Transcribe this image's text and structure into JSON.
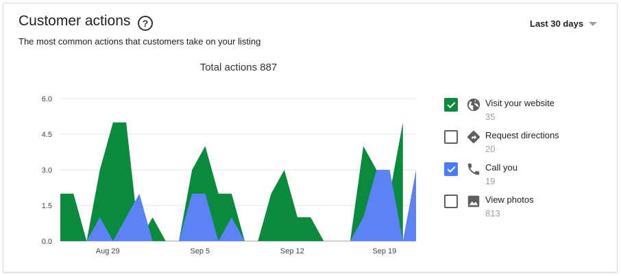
{
  "header": {
    "title": "Customer actions",
    "help_icon": "?",
    "subtitle": "The most common actions that customers take on your listing",
    "date_range": "Last 30 days"
  },
  "chart": {
    "total_label": "Total actions 887"
  },
  "legend": [
    {
      "label": "Visit your website",
      "count": "35",
      "checked": true,
      "color": "#0a8a3c",
      "icon": "globe-icon"
    },
    {
      "label": "Request directions",
      "count": "20",
      "checked": false,
      "color": "#5f5f5f",
      "icon": "directions-icon"
    },
    {
      "label": "Call you",
      "count": "19",
      "checked": true,
      "color": "#4a7cff",
      "icon": "phone-icon"
    },
    {
      "label": "View photos",
      "count": "813",
      "checked": false,
      "color": "#5f5f5f",
      "icon": "photo-icon"
    }
  ],
  "chart_data": {
    "type": "area",
    "title": "Total actions 887",
    "y_ticks": [
      "0.0",
      "1.5",
      "3.0",
      "4.5",
      "6.0"
    ],
    "ylim": [
      0,
      6
    ],
    "x_ticks": [
      "Aug 29",
      "Sep 5",
      "Sep 12",
      "Sep 19"
    ],
    "x_tick_index": [
      3.6,
      10.6,
      17.6,
      24.6
    ],
    "stacked": true,
    "series": [
      {
        "name": "Visit your website",
        "color": "#0a8a3c",
        "values": [
          [
            0,
            0.0
          ],
          [
            0,
            2
          ],
          [
            1,
            2
          ],
          [
            2,
            0
          ],
          [
            3,
            3
          ],
          [
            4,
            5
          ],
          [
            5,
            5
          ],
          [
            6,
            0
          ],
          [
            7,
            1
          ],
          [
            8,
            0
          ],
          [
            9,
            0
          ],
          [
            10,
            3
          ],
          [
            11,
            4
          ],
          [
            12,
            2
          ],
          [
            13,
            2
          ],
          [
            14,
            0
          ],
          [
            15,
            0
          ],
          [
            16,
            2
          ],
          [
            17,
            3
          ],
          [
            18,
            1
          ],
          [
            19,
            1
          ],
          [
            20,
            0
          ],
          [
            21,
            0
          ],
          [
            22,
            0
          ],
          [
            23,
            4
          ],
          [
            24,
            3
          ],
          [
            25,
            2
          ],
          [
            26,
            5
          ]
        ]
      },
      {
        "name": "Call you",
        "color": "#5b82f7",
        "values": [
          [
            0,
            0
          ],
          [
            1,
            0
          ],
          [
            2,
            0
          ],
          [
            3,
            1
          ],
          [
            4,
            0
          ],
          [
            5,
            1
          ],
          [
            6,
            2
          ],
          [
            7,
            0
          ],
          [
            8,
            0
          ],
          [
            9,
            0
          ],
          [
            10,
            2
          ],
          [
            11,
            2
          ],
          [
            12,
            0
          ],
          [
            13,
            1
          ],
          [
            14,
            0
          ],
          [
            15,
            0
          ],
          [
            16,
            0
          ],
          [
            17,
            0
          ],
          [
            18,
            0
          ],
          [
            19,
            0
          ],
          [
            20,
            0
          ],
          [
            21,
            0
          ],
          [
            22,
            0
          ],
          [
            23,
            1
          ],
          [
            24,
            3
          ],
          [
            25,
            3
          ],
          [
            26,
            0
          ],
          [
            27,
            3
          ]
        ]
      }
    ]
  }
}
